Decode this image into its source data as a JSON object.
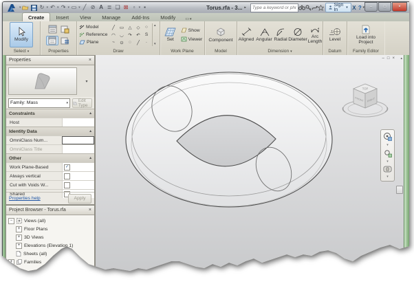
{
  "titlebar": {
    "title": "Torus.rfa - 3...",
    "search_placeholder": "Type a keyword or phrase",
    "signin_label": "Sign In",
    "exchange_label": "X",
    "help_label": "?",
    "min_glyph": "–",
    "restore_glyph": "□",
    "close_glyph": "×",
    "qat_icons": [
      "revit-logo",
      "open",
      "save",
      "sync",
      "undo",
      "redo",
      "measure",
      "modify-line",
      "tag",
      "text",
      "sheet-list",
      "window"
    ]
  },
  "tabs": {
    "items": [
      {
        "label": "Create"
      },
      {
        "label": "Insert"
      },
      {
        "label": "View"
      },
      {
        "label": "Manage"
      },
      {
        "label": "Add-Ins"
      },
      {
        "label": "Modify"
      }
    ],
    "toggle_glyph": "▭",
    "toggle_arrow": "▾"
  },
  "ribbon": {
    "select": {
      "button": "Modify",
      "group": "Select",
      "arrow": "▾"
    },
    "properties_group": {
      "group": "Properties"
    },
    "draw": {
      "group": "Draw",
      "buttons": [
        {
          "label": "Model"
        },
        {
          "label": "Reference"
        },
        {
          "label": "Plane"
        }
      ],
      "tools": [
        "╱",
        "▭",
        "△",
        "◇",
        "○",
        "◠",
        "◡",
        "↷",
        "↶",
        "S",
        "~",
        "⊙",
        "◌",
        "╱",
        "·"
      ],
      "scroll_up": "▴",
      "scroll_down": "▾"
    },
    "workplane": {
      "group": "Work Plane",
      "set": "Set",
      "show": "Show",
      "viewer": "Viewer"
    },
    "model": {
      "group": "Model",
      "component": "Component"
    },
    "dimension": {
      "group": "Dimension",
      "arrow": "▾",
      "items": [
        {
          "label": "Aligned"
        },
        {
          "label": "Angular"
        },
        {
          "label": "Radial"
        },
        {
          "label": "Diameter"
        },
        {
          "label": "Arc Length"
        }
      ]
    },
    "datum": {
      "group": "Datum",
      "level": "Level"
    },
    "family_editor": {
      "group": "Family Editor",
      "load": "Load into Project"
    }
  },
  "properties_palette": {
    "header": "Properties",
    "close_glyph": "×",
    "family_selector": "Family: Mass",
    "selector_arrow": "▾",
    "edit_type": "Edit Type",
    "sections": {
      "constraints": {
        "title": "Constraints",
        "pin": "▴",
        "rows": [
          {
            "label": "Host",
            "value": ""
          }
        ]
      },
      "identity": {
        "title": "Identity Data",
        "pin": "▴",
        "rows": [
          {
            "label": "OmniClass Num...",
            "value": ""
          },
          {
            "label": "OmniClass Title",
            "value": ""
          }
        ]
      },
      "other": {
        "title": "Other",
        "pin": "▴",
        "rows": [
          {
            "label": "Work Plane-Based",
            "check": "✓"
          },
          {
            "label": "Always vertical",
            "check": ""
          },
          {
            "label": "Cut with Voids W...",
            "check": ""
          },
          {
            "label": "Shared",
            "check": ""
          }
        ]
      }
    },
    "help_link": "Properties help",
    "apply": "Apply"
  },
  "project_browser": {
    "header": "Project Browser - Torus.rfa",
    "close_glyph": "×",
    "items": [
      {
        "expander": "−",
        "label": "Views (all)"
      },
      {
        "expander": "+",
        "label": "Floor Plans"
      },
      {
        "expander": "+",
        "label": "3D Views"
      },
      {
        "expander": "+",
        "label": "Elevations (Elevation 1)"
      },
      {
        "expander": "",
        "label": "Sheets (all)"
      },
      {
        "expander": "+",
        "label": "Families"
      }
    ]
  },
  "canvas": {
    "viewcube": {
      "top": "TOP",
      "front": "FRONT",
      "right": "RIGHT"
    },
    "window_controls": {
      "min": "–",
      "restore": "□",
      "close": "×",
      "arrow": "▴"
    }
  },
  "colors": {
    "ribbon_bg": "#d8d5ca",
    "modify_blue": "#a9cae8",
    "green_border": "#8fb989",
    "close_red": "#c0392b",
    "canvas_top": "#ededee",
    "canvas_bottom": "#c7c8ca"
  }
}
